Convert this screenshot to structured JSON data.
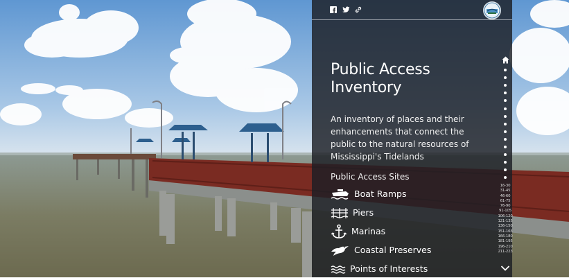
{
  "header": {
    "share_icons": [
      "facebook-icon",
      "twitter-icon",
      "link-icon"
    ],
    "logo": "agency-seal-logo"
  },
  "story": {
    "title": "Public Access Inventory",
    "description": "An inventory of places and their enhancements that connect the public to the natural resources of Mississippi's Tidelands",
    "sites_heading": "Public Access Sites",
    "sites": [
      {
        "label": "Boat Ramps",
        "icon": "boat-icon"
      },
      {
        "label": "Piers",
        "icon": "pier-icon"
      },
      {
        "label": "Marinas",
        "icon": "anchor-icon"
      },
      {
        "label": "Coastal Preserves",
        "icon": "bird-icon"
      },
      {
        "label": "Points of Interests",
        "icon": "waves-icon"
      }
    ]
  },
  "nav": {
    "home_icon": "home-icon",
    "section_count": 15,
    "ranges": [
      "16-30",
      "31-45",
      "46-60",
      "61-75",
      "76-90",
      "91-105",
      "106-120",
      "121-135",
      "136-150",
      "151-165",
      "166-180",
      "181-195",
      "196-210",
      "211-223"
    ],
    "down_icon": "chevron-down-icon"
  },
  "colors": {
    "panel": "#1c1e24",
    "sky": "#7fb2e0",
    "water": "#8a8a70",
    "rail": "#7a2b22",
    "shelter": "#2d5f8e"
  }
}
